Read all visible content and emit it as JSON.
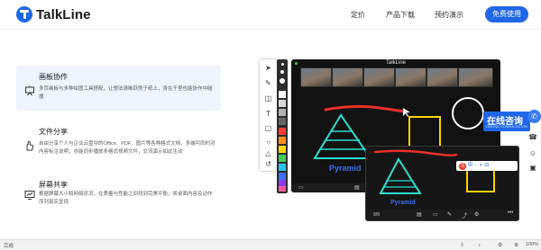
{
  "header": {
    "logo_text": "TalkLine",
    "nav": {
      "pricing": "定价",
      "download": "产品下载",
      "demo": "预约演示"
    },
    "cta": "免费使用"
  },
  "features": [
    {
      "title": "画板协作",
      "desc": "多页画板与多种绘图工具搭配，让想法清晰跃然于纸上，身在千里也能协作中碰撞",
      "icon": "whiteboard-icon"
    },
    {
      "title": "文件分享",
      "desc": "自由分享个人与企业云盘中的Office、PDF、图片等各种格式文档，多端可同时对内容标注说明，亦能同步播放多格式视频文件，交流演示如此生动",
      "icon": "hand-share-icon"
    },
    {
      "title": "屏幕共享",
      "desc": "根据屏幕大小和网络状况，在质量与性能之间找到完美平衡，将桌面内容及动作序列真实呈现",
      "icon": "screen-share-icon"
    }
  ],
  "window": {
    "title": "TalkLine",
    "sketch_label_main": "Pyramid",
    "sketch_label_second": "Pyramid",
    "page_indicator": "9/9"
  },
  "ime": {
    "logo": "S",
    "text": "中 ·· ◐ ⊡"
  },
  "consult": {
    "main": "在线咨询",
    "sub": "ONLINE CONSULTATION"
  },
  "status": {
    "left": "完成",
    "zoom": "100%"
  },
  "colors": {
    "brand": "#1f67e8",
    "palette": [
      "#222222",
      "#ffffff",
      "#d9d9d9",
      "#b3b3b3",
      "#ff3b30",
      "#ff8c1a",
      "#ffd400",
      "#3ecf5c",
      "#27c6e8",
      "#3b6ff0",
      "#8b3cf0",
      "#ff5aa0"
    ]
  }
}
